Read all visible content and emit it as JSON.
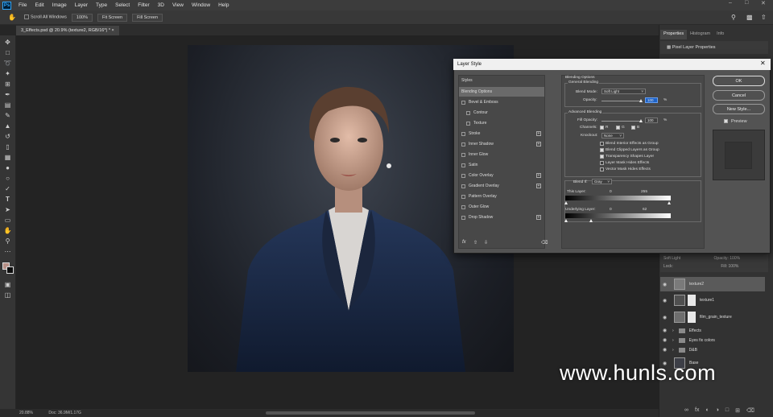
{
  "menubar": {
    "app_icon": "Ps",
    "items": [
      "File",
      "Edit",
      "Image",
      "Layer",
      "Type",
      "Select",
      "Filter",
      "3D",
      "View",
      "Window",
      "Help"
    ]
  },
  "options": {
    "scroll_all_windows": "Scroll All Windows",
    "zoom": "100%",
    "fit_screen": "Fit Screen",
    "fill_screen": "Fill Screen"
  },
  "document": {
    "tab_title": "3_Effects.psd @ 20.9% (texture2, RGB/16*) *",
    "zoom_status": "20.88%",
    "doc_status": "Doc: 36.9M/1.17G"
  },
  "right_panel": {
    "tabs": [
      "Properties",
      "Histogram",
      "Info"
    ],
    "properties_title": "Pixel Layer Properties",
    "layers_header_mode": "Soft Light",
    "layers_header_opacity": "Opacity: 100%",
    "layers_header_lock": "Lock:",
    "layers_header_fill": "Fill: 100%",
    "layers": [
      "texture2",
      "texture1",
      "film_grain_texture",
      "Effects",
      "Eyes fix colors",
      "D&B",
      "Base"
    ]
  },
  "dialog": {
    "title": "Layer Style",
    "styles_header": "Styles",
    "styles": [
      {
        "label": "Blending Options",
        "checkbox": false,
        "plus": false,
        "selected": true
      },
      {
        "label": "Bevel & Emboss",
        "checkbox": true,
        "plus": false
      },
      {
        "label": "Contour",
        "checkbox": true,
        "plus": false,
        "indent": true
      },
      {
        "label": "Texture",
        "checkbox": true,
        "plus": false,
        "indent": true
      },
      {
        "label": "Stroke",
        "checkbox": true,
        "plus": true
      },
      {
        "label": "Inner Shadow",
        "checkbox": true,
        "plus": true
      },
      {
        "label": "Inner Glow",
        "checkbox": true,
        "plus": false
      },
      {
        "label": "Satin",
        "checkbox": true,
        "plus": false
      },
      {
        "label": "Color Overlay",
        "checkbox": true,
        "plus": true
      },
      {
        "label": "Gradient Overlay",
        "checkbox": true,
        "plus": true
      },
      {
        "label": "Pattern Overlay",
        "checkbox": true,
        "plus": false
      },
      {
        "label": "Outer Glow",
        "checkbox": true,
        "plus": false
      },
      {
        "label": "Drop Shadow",
        "checkbox": true,
        "plus": true
      }
    ],
    "fx_label": "fx",
    "blending_options": "Blending Options",
    "general_blending": "General Blending",
    "blend_mode_label": "Blend Mode:",
    "blend_mode": "Soft Light",
    "opacity_label": "Opacity:",
    "opacity": "100",
    "percent": "%",
    "advanced_blending": "Advanced Blending",
    "fill_opacity_label": "Fill Opacity:",
    "fill_opacity": "100",
    "channels_label": "Channels:",
    "channel_r": "R",
    "channel_g": "G",
    "channel_b": "B",
    "knockout_label": "Knockout:",
    "knockout": "None",
    "options": [
      {
        "label": "Blend Interior Effects as Group",
        "checked": false
      },
      {
        "label": "Blend Clipped Layers as Group",
        "checked": true
      },
      {
        "label": "Transparency Shapes Layer",
        "checked": true
      },
      {
        "label": "Layer Mask Hides Effects",
        "checked": false
      },
      {
        "label": "Vector Mask Hides Effects",
        "checked": false
      }
    ],
    "blend_if_label": "Blend If:",
    "blend_if": "Gray",
    "this_layer_label": "This Layer:",
    "this_layer_min": "0",
    "this_layer_max": "255",
    "underlying_label": "Underlying Layer:",
    "underlying_min": "0",
    "underlying_max": "62",
    "underlying_fraction": 0.243,
    "ok": "OK",
    "cancel": "Cancel",
    "new_style": "New Style...",
    "preview_label": "Preview"
  },
  "watermark": "www.hunls.com",
  "colors": {
    "dialog_bg": "#535353",
    "panel_bg": "#484848",
    "workspace": "#262626"
  }
}
